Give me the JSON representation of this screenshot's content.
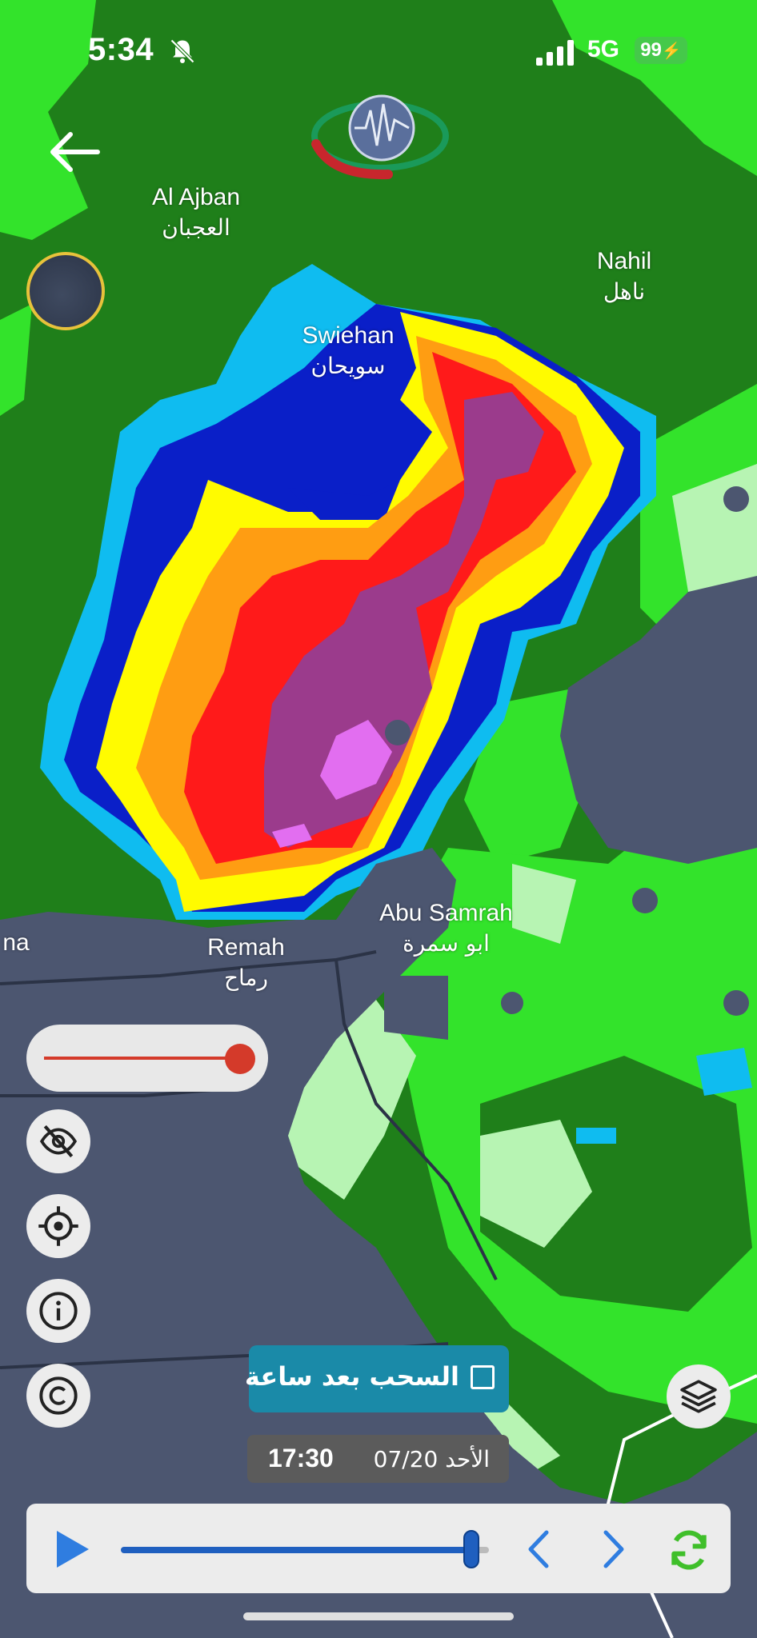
{
  "status_bar": {
    "time": "5:34",
    "network": "5G",
    "battery": "99"
  },
  "map_labels": {
    "al_ajban": {
      "en": "Al Ajban",
      "ar": "العجبان"
    },
    "nahil": {
      "en": "Nahil",
      "ar": "ناهل"
    },
    "swiehan": {
      "en": "Swiehan",
      "ar": "سويحان"
    },
    "abu_samrah": {
      "en": "Abu Samrah",
      "ar": "ابو سمرة"
    },
    "remah": {
      "en": "Remah",
      "ar": "رماح"
    },
    "edge_fragment": "na"
  },
  "controls": {
    "opacity_level": 1.0,
    "clouds_checkbox_label": "السحب بعد ساعة",
    "clouds_checked": false,
    "timestamp_time": "17:30",
    "timestamp_date": "الأحد 07/20",
    "timeline_progress": 0.95
  },
  "icons": [
    "back-arrow-icon",
    "app-logo-icon",
    "eye-off-icon",
    "target-icon",
    "info-icon",
    "copyright-icon",
    "layers-icon",
    "play-icon",
    "chevron-left-icon",
    "chevron-right-icon",
    "refresh-icon",
    "bell-slash-icon",
    "signal-icon"
  ],
  "colors": {
    "map_green": "#1f7f1a",
    "light_green": "#33e32b",
    "pale_green": "#b7f4b3",
    "cyan": "#0fbcf0",
    "blue": "#0a1fc8",
    "yellow": "#fffb00",
    "orange": "#ff9d12",
    "red": "#ff1a1a",
    "purple": "#9b3b8c",
    "magenta": "#e26ef0",
    "ground": "#4c5670",
    "accent_blue": "#1f5fbf",
    "refresh_green": "#3fbf2a"
  }
}
